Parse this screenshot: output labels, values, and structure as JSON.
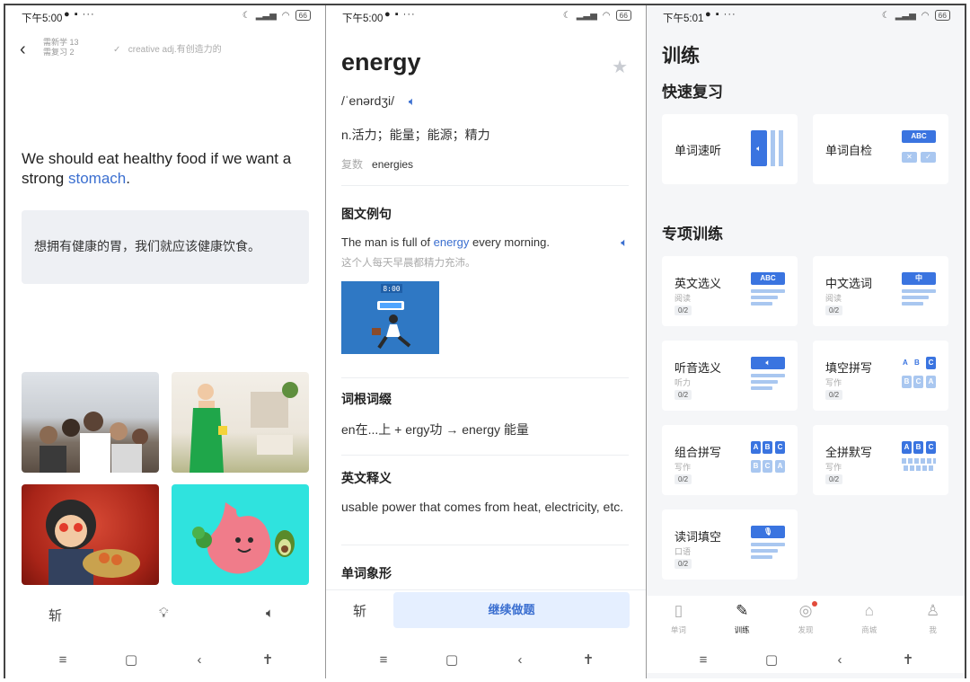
{
  "status": {
    "p1_time": "下午5:00",
    "p2_time": "下午5:00",
    "p3_time": "下午5:01",
    "battery": "66"
  },
  "study": {
    "stat_new": "需新学 13",
    "stat_review": "需复习 2",
    "prev_word": "creative adj.有创造力的",
    "sentence_before": "We should eat healthy food if we want a strong ",
    "sentence_word": "stomach",
    "sentence_after": ".",
    "translation": "想拥有健康的胃，我们就应该健康饮食。",
    "toolbar": {
      "zhan": "斩",
      "hint_icon": "bulb-icon",
      "sound_icon": "speaker-icon"
    }
  },
  "word": {
    "title": "energy",
    "phonetic": "/ˈenərdʒi/",
    "definition": "n.活力；能量；能源；精力",
    "plural_label": "复数",
    "plural_value": "energies",
    "sec_example": "图文例句",
    "example_before": "The man is full of ",
    "example_word": "energy",
    "example_after": " every morning.",
    "example_cn": "这个人每天早晨都精力充沛。",
    "image_clock": "8:00",
    "sec_root": "词根词缀",
    "root_text": "en在...上 + ergy功 → energy 能量",
    "sec_en_def": "英文释义",
    "en_def": "usable power that comes from heat, electricity, etc.",
    "sec_pictograph": "单词象形",
    "zhan": "斩",
    "continue": "继续做题"
  },
  "training": {
    "title": "训练",
    "quick_title": "快速复习",
    "quick": [
      {
        "label": "单词速听"
      },
      {
        "label": "单词自检",
        "icon_text": "ABC"
      }
    ],
    "special_title": "专项训练",
    "cards": [
      {
        "label": "英文选义",
        "sub": "阅读",
        "badge": "0/2",
        "icon_text": "ABC"
      },
      {
        "label": "中文选词",
        "sub": "阅读",
        "badge": "0/2",
        "icon_text": "中"
      },
      {
        "label": "听音选义",
        "sub": "听力",
        "badge": "0/2"
      },
      {
        "label": "填空拼写",
        "sub": "写作",
        "badge": "0/2"
      },
      {
        "label": "组合拼写",
        "sub": "写作",
        "badge": "0/2"
      },
      {
        "label": "全拼默写",
        "sub": "写作",
        "badge": "0/2"
      },
      {
        "label": "读词填空",
        "sub": "口语",
        "badge": "0/2"
      }
    ],
    "tabs": [
      {
        "label": "单词",
        "icon": "book-icon"
      },
      {
        "label": "训练",
        "icon": "edit-icon"
      },
      {
        "label": "发现",
        "icon": "compass-icon"
      },
      {
        "label": "商城",
        "icon": "store-icon"
      },
      {
        "label": "我",
        "icon": "user-icon"
      }
    ]
  }
}
